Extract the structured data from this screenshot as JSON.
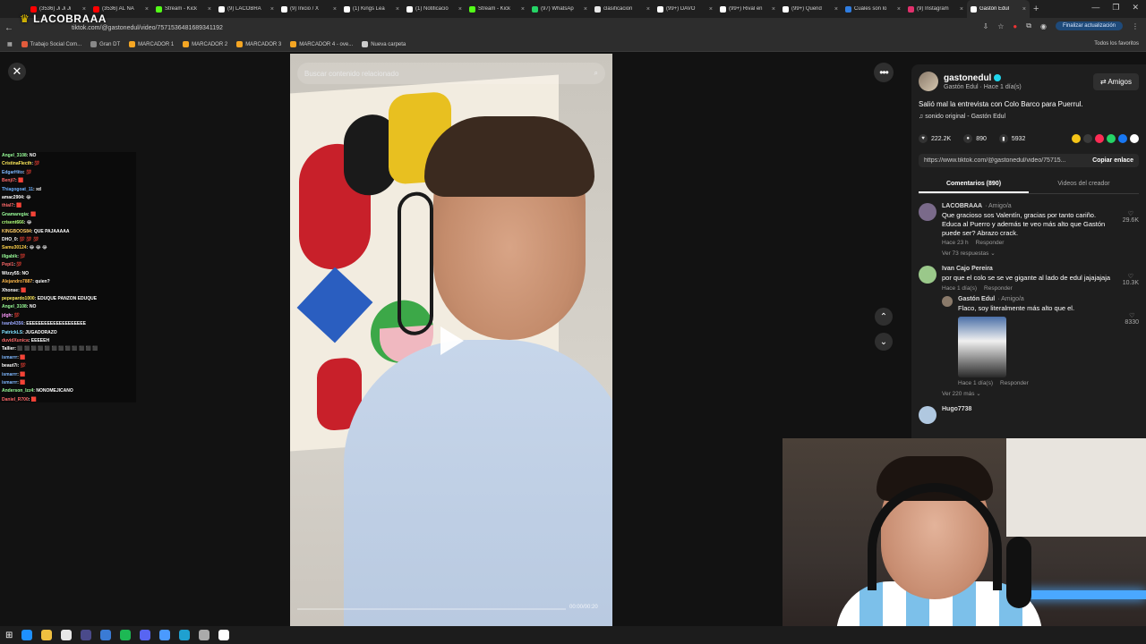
{
  "browser": {
    "tabs": [
      {
        "label": "(3536) Ji Ji Ji",
        "color": "#ff0000",
        "active": false
      },
      {
        "label": "(3536) AL NA",
        "color": "#ff0000",
        "active": false
      },
      {
        "label": "Stream - Kick",
        "color": "#53fc18",
        "active": false
      },
      {
        "label": "(9) LACOBRA",
        "color": "#ffffff",
        "active": false
      },
      {
        "label": "(9) Inicio / X",
        "color": "#ffffff",
        "active": false
      },
      {
        "label": "(1) Kings Lea",
        "color": "#ffffff",
        "active": false
      },
      {
        "label": "(1) Notificació",
        "color": "#ffffff",
        "active": false
      },
      {
        "label": "Stream - Kick",
        "color": "#53fc18",
        "active": false
      },
      {
        "label": "(97) WhatsAp",
        "color": "#25d366",
        "active": false
      },
      {
        "label": "clasificacion",
        "color": "#e8e8e8",
        "active": false
      },
      {
        "label": "(99+) DAVO",
        "color": "#ffffff",
        "active": false
      },
      {
        "label": "(99+) Rival en",
        "color": "#ffffff",
        "active": false
      },
      {
        "label": "(99+) Querid",
        "color": "#ffffff",
        "active": false
      },
      {
        "label": "Cuáles son lo",
        "color": "#2f7de1",
        "active": false
      },
      {
        "label": "(9) Instagram",
        "color": "#e1306c",
        "active": false
      },
      {
        "label": "Gastón Edul",
        "color": "#ffffff",
        "active": true
      }
    ],
    "tab_close": "×",
    "new_tab": "+",
    "url": "tiktok.com/@gastonedul/video/7571536481689341192",
    "update_label": "Finalizar actualización",
    "bookmarks": [
      {
        "label": "Trabajo Social Com...",
        "color": "#e25b3c"
      },
      {
        "label": "Gran DT",
        "color": "#888888"
      },
      {
        "label": "MARCADOR 1",
        "color": "#f5a623"
      },
      {
        "label": "MARCADOR 2",
        "color": "#f5a623"
      },
      {
        "label": "MARCADOR 3",
        "color": "#f5a623"
      },
      {
        "label": "MARCADOR 4 - ove...",
        "color": "#f5a623"
      },
      {
        "label": "Nueva carpeta",
        "color": "#cccccc"
      }
    ],
    "all_bookmarks": "Todos los favoritos"
  },
  "overlay": {
    "logo": "LACOBRAAA"
  },
  "chat": [
    {
      "user": "Angel_3108",
      "msg": ": NO",
      "color": "#9aff9a"
    },
    {
      "user": "CristinaFlecth",
      "msg": ": 💯",
      "color": "#ffea5a"
    },
    {
      "user": "EdgarHito",
      "msg": ": 💯",
      "color": "#7fb8ff"
    },
    {
      "user": "Benji7",
      "msg": ": 🟥",
      "color": "#ff6a6a"
    },
    {
      "user": "Thiagogoat_11",
      "msg": ": xd",
      "color": "#6ab0ff"
    },
    {
      "user": "amac2904",
      "msg": ": 😂",
      "color": "#ffffff"
    },
    {
      "user": "thial7",
      "msg": ": 🟥",
      "color": "#ff6a6a"
    },
    {
      "user": "Gnamaregia",
      "msg": ": 🟥",
      "color": "#9aff9a"
    },
    {
      "user": "crisent666",
      "msg": ": 😂",
      "color": "#b0ff7a"
    },
    {
      "user": "KINGBOOS84",
      "msg": ": QUE PAJAAAAA",
      "color": "#ffcc66"
    },
    {
      "user": "DHO_0",
      "msg": ": 💯 💯 💯",
      "color": "#ffffff"
    },
    {
      "user": "Samu30124",
      "msg": ": 😂 😂 😂",
      "color": "#ffd24a"
    },
    {
      "user": "illgabik",
      "msg": ": 💯",
      "color": "#9aff9a"
    },
    {
      "user": "Pepi1",
      "msg": ": 💯",
      "color": "#ff6a6a"
    },
    {
      "user": "Wizzy55",
      "msg": ": NO",
      "color": "#ffffff"
    },
    {
      "user": "Alejandro7887",
      "msg": ": quien?",
      "color": "#ffb84a"
    },
    {
      "user": "Xhonse",
      "msg": ": 🟥",
      "color": "#ffffff"
    },
    {
      "user": "pepepardo1000",
      "msg": ": EDUQUE PANZON EDUQUE",
      "color": "#ffea5a"
    },
    {
      "user": "Angel_3108",
      "msg": ": NO",
      "color": "#9aff9a"
    },
    {
      "user": "jdgh",
      "msg": ": 💯",
      "color": "#ff9aff"
    },
    {
      "user": "ivanb4356",
      "msg": ": EEEEEEEEEEEEEEEEEEEE",
      "color": "#9aa8ff"
    },
    {
      "user": "PatrickLS",
      "msg": ": JUGADORAZO",
      "color": "#7fe0ff"
    },
    {
      "user": "duvidXunica",
      "msg": ": EEEEEH",
      "color": "#ff6a6a"
    },
    {
      "user": "Tallier",
      "msg": ": ⬛ ⬛ ⬛ ⬛ ⬛ ⬛ ⬛ ⬛ ⬛ ⬛ ⬛ ⬛",
      "color": "#ffffff"
    },
    {
      "user": "ismarrr",
      "msg": ": 🟥",
      "color": "#7fb8ff"
    },
    {
      "user": "beaut7i",
      "msg": ": 💯",
      "color": "#ffffff"
    },
    {
      "user": "ismarrr",
      "msg": ": 🟥",
      "color": "#7fb8ff"
    },
    {
      "user": "ismarrr",
      "msg": ": 🟥",
      "color": "#7fb8ff"
    },
    {
      "user": "Anderson_Izz4",
      "msg": ": NONOMEJICANO",
      "color": "#9aff9a"
    },
    {
      "user": "Daniel_R700",
      "msg": ": 🟥",
      "color": "#ff6a6a"
    }
  ],
  "page": {
    "close_icon": "✕",
    "more_icon": "•••",
    "nav_up": "⌃",
    "nav_down": "⌄"
  },
  "video": {
    "search_placeholder": "Buscar contenido relacionado",
    "progress": 0.0,
    "timecode": "00:00/00:20"
  },
  "panel": {
    "author": "gastonedul",
    "author_sub": "Gastón Edul · Hace 1 día(s)",
    "friends_label": "Amigos",
    "caption": "Salió mal la entrevista con Colo Barco para Puerrul.",
    "sound": "sonido original - Gastón Edul",
    "likes": "222.2K",
    "comments": "890",
    "saves": "5932",
    "share_colors": [
      "#f5c518",
      "#3a3a3a",
      "#fe2c55",
      "#25d366",
      "#1877f2",
      "#ffffff"
    ],
    "link": "https://www.tiktok.com/@gastonedul/video/75715...",
    "copy_label": "Copiar enlace",
    "tab_comments": "Comentarios (890)",
    "tab_videos": "Videos del creador"
  },
  "comments": [
    {
      "user": "LACOBRAAA",
      "tag": "· Amigo/a",
      "text": "Que gracioso sos Valentín, gracias por tanto cariño. Educa al Puerro y además te veo más alto que Gastón puede ser? Abrazo crack.",
      "time": "Hace 23 h",
      "reply_label": "Responder",
      "replies": "Ver 73 respuestas ⌄",
      "likes": "29.6K",
      "avatar": "#7a6a8a"
    },
    {
      "user": "Ivan Cajo Pereira",
      "tag": "",
      "text": "por que el colo se se ve gigante al lado de edul jajajajaja",
      "time": "Hace 1 día(s)",
      "reply_label": "Responder",
      "likes": "10.3K",
      "avatar": "#9ac88a"
    }
  ],
  "reply": {
    "user": "Gastón Edul",
    "tag": "· Amigo/a",
    "text": "Flaco, soy literalmente más alto que el.",
    "time": "Hace 1 día(s)",
    "reply_label": "Responder",
    "likes": "8330",
    "more_replies": "Ver 220 más ⌄"
  },
  "next_comment_user": "Hugo7738",
  "taskbar": [
    "#1e90ff",
    "#f0c040",
    "#e8e8e8",
    "#4a4a8a",
    "#3a7bd5",
    "#1db954",
    "#5865f2",
    "#4a9aff",
    "#1fa0d0",
    "#aaaaaa",
    "#ffffff"
  ]
}
